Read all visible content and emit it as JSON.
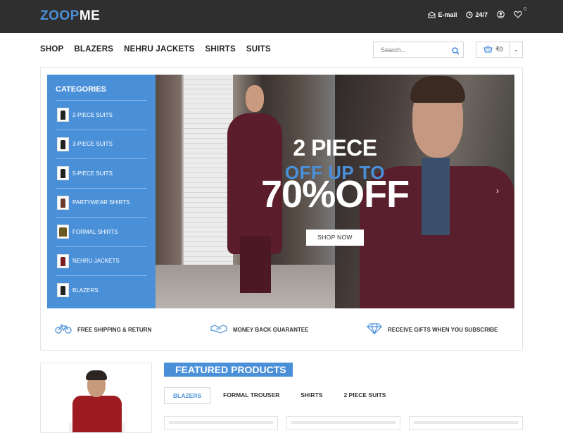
{
  "brand": {
    "part1": "ZOOP",
    "part2": "ME"
  },
  "topbar": {
    "email_label": "E-mail",
    "support_label": "24/7",
    "wishlist_count": "0"
  },
  "nav": {
    "items": [
      "SHOP",
      "BLAZERS",
      "NEHRU JACKETS",
      "SHIRTS",
      "SUITS"
    ]
  },
  "search": {
    "placeholder": "Search..."
  },
  "cart": {
    "total": "₹0"
  },
  "categories": {
    "title": "CATEGORIES",
    "items": [
      "2-PIECE SUITS",
      "3-PIECE SUITS",
      "5-PIECE SUITS",
      "PARTYWEAR SHIRTS",
      "FORMAL SHIRTS",
      "NEHRU JACKETS",
      "BLAZERS"
    ]
  },
  "hero": {
    "line1": "2 PIECE",
    "line2": "OFF UP TO",
    "line3": "70%OFF",
    "button": "SHOP NOW",
    "next_arrow": "›"
  },
  "features": [
    "FREE SHIPPING & RETURN",
    "MONEY BACK GUARANTEE",
    "RECEIVE GIFTS WHEN YOU SUBSCRIBE"
  ],
  "featured": {
    "title": "FEATURED PRODUCTS",
    "tabs": [
      "BLAZERS",
      "FORMAL TROUSER",
      "SHIRTS",
      "2 PIECE SUITS"
    ]
  },
  "colors": {
    "accent": "#4a90d9",
    "topbar": "#2f2f2f",
    "suit": "#5a1d29"
  },
  "icons": [
    "email-icon",
    "clock-icon",
    "user-icon",
    "heart-icon",
    "search-icon",
    "basket-icon",
    "bicycle-icon",
    "handshake-icon",
    "diamond-icon",
    "chevron-right-icon"
  ]
}
